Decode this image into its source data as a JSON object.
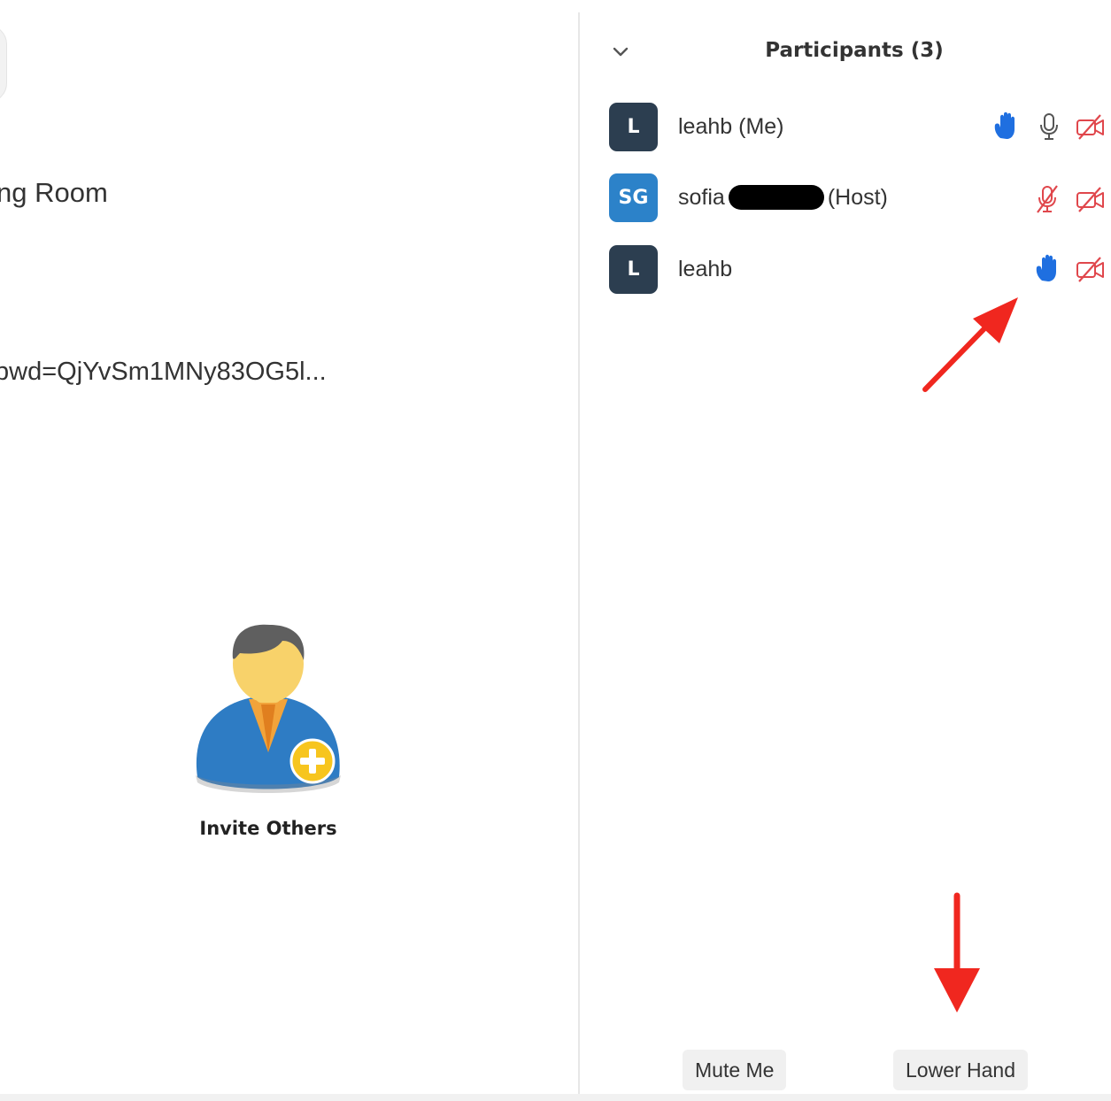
{
  "left": {
    "room_title": "ng Room",
    "meeting_url": "pwd=QjYvSm1MNy83OG5l...",
    "invite_label": "Invite Others"
  },
  "participants_panel": {
    "title": "Participants (3)",
    "rows": [
      {
        "initials": "L",
        "name": "leahb",
        "tag": "(Me)",
        "avatar_color": "#2c3e50",
        "hand_raised": true,
        "mic": "on",
        "video": "off"
      },
      {
        "initials": "SG",
        "name": "sofia",
        "tag": "(Host)",
        "avatar_color": "#2c82c9",
        "hand_raised": false,
        "mic": "muted",
        "video": "off"
      },
      {
        "initials": "L",
        "name": "leahb",
        "tag": "",
        "avatar_color": "#2c3e50",
        "hand_raised": true,
        "mic": "none",
        "video": "off"
      }
    ],
    "footer": {
      "mute_me": "Mute Me",
      "lower_hand": "Lower Hand"
    }
  },
  "icons": {
    "collapse": "chevron-down-icon",
    "raised_hand": "raised-hand-icon",
    "microphone": "microphone-icon",
    "muted_microphone": "muted-microphone-icon",
    "video_off": "video-off-icon",
    "invite": "add-person-icon"
  },
  "colors": {
    "hand_blue": "#1f6fe0",
    "muted_red": "#e0474c",
    "annotation_red": "#f0271f",
    "avatar_dark": "#2c3e50",
    "avatar_blue": "#2c82c9"
  }
}
